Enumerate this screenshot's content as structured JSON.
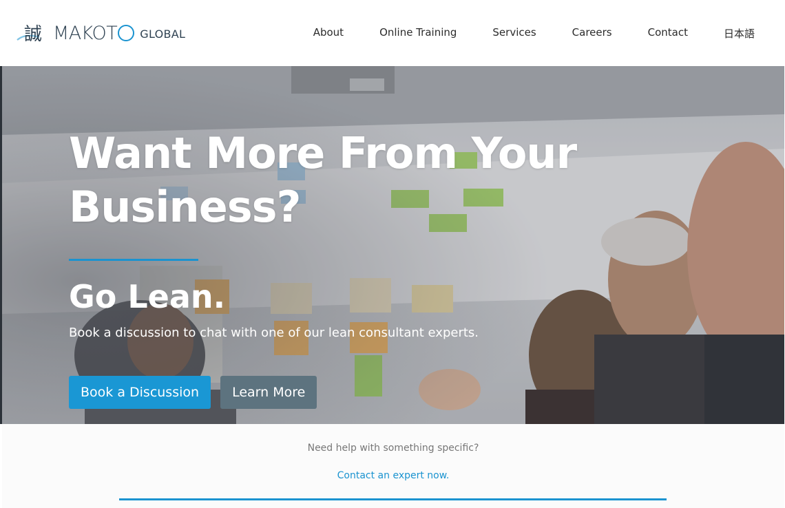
{
  "header": {
    "logo": {
      "kanji": "誠",
      "brand_prefix": "MAKOT",
      "brand_o": "O",
      "brand_suffix": "GLOBAL"
    },
    "nav": [
      {
        "label": "About"
      },
      {
        "label": "Online Training"
      },
      {
        "label": "Services"
      },
      {
        "label": "Careers"
      },
      {
        "label": "Contact"
      },
      {
        "label": "日本語"
      }
    ]
  },
  "hero": {
    "title_line1": "Want More From Your",
    "title_line2": "Business?",
    "tagline": "Go Lean.",
    "subtitle": "Book a discussion to chat with one of our lean consultant experts.",
    "primary_button": "Book a Discussion",
    "secondary_button": "Learn More"
  },
  "help": {
    "question": "Need help with something specific?",
    "link": "Contact an expert now."
  },
  "colors": {
    "accent": "#1a93d0",
    "secondary_button": "#5d737f",
    "brand_text": "#2f4252"
  }
}
